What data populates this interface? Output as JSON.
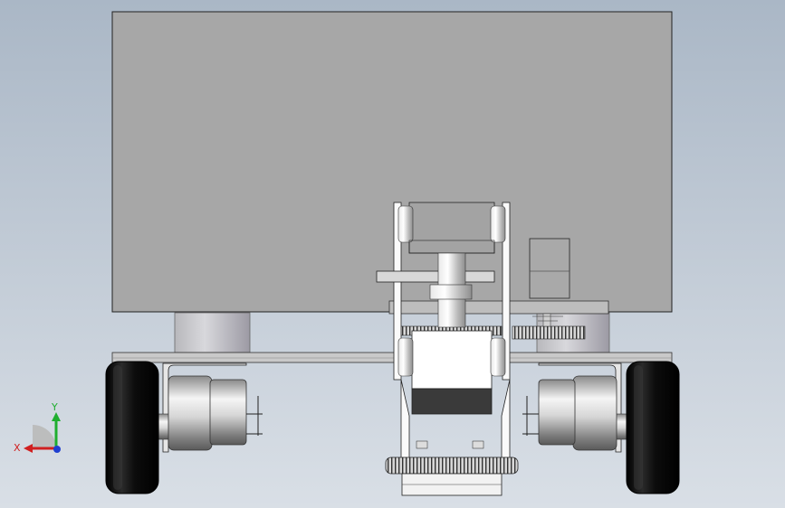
{
  "viewport": {
    "background_top": "#aab7c6",
    "background_bottom": "#d9dfe6"
  },
  "model": {
    "body_color": "#a7a7a7",
    "wheel_color": "#111111",
    "metal_color": "#c8c8c8",
    "outline_color": "#222222"
  },
  "triad": {
    "x_label": "X",
    "y_label": "Y",
    "x_color": "#d01f1f",
    "y_color": "#1fae2f",
    "z_color": "#1f3fd0"
  }
}
